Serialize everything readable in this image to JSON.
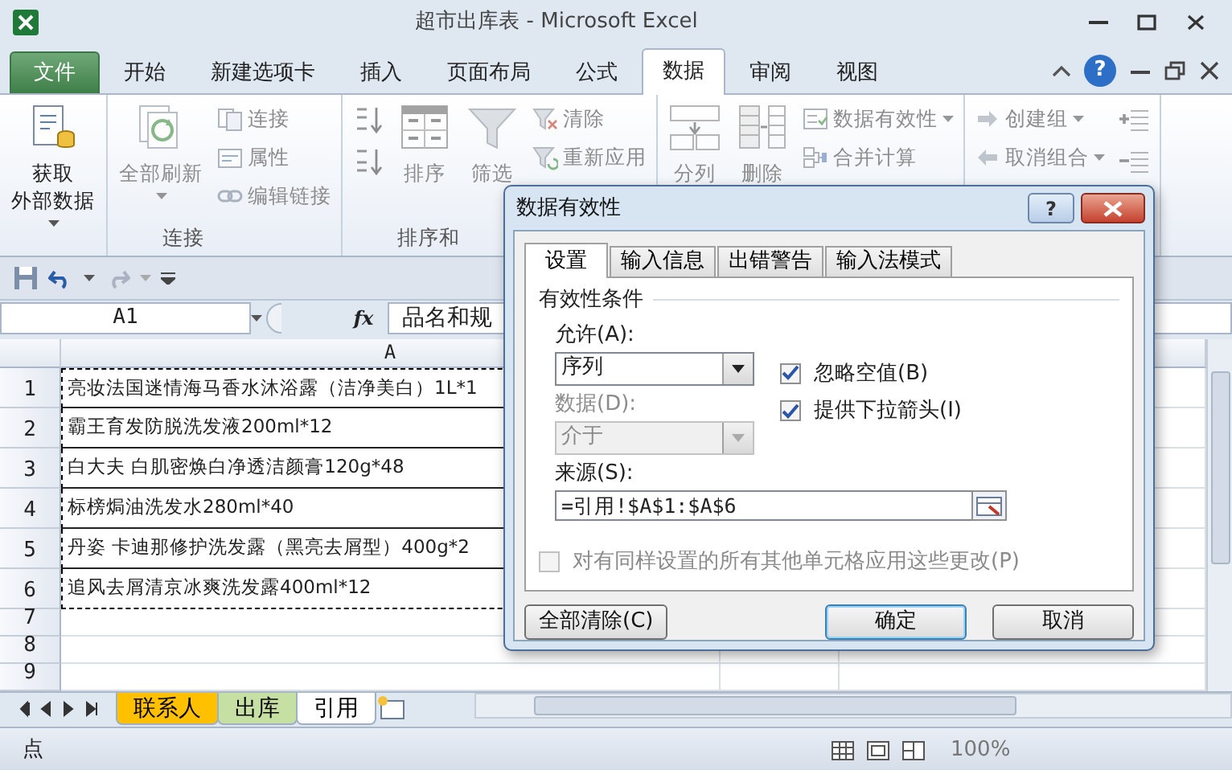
{
  "window": {
    "title": "超市出库表 - Microsoft Excel"
  },
  "ribbon_tabs": [
    {
      "label": "文件",
      "kind": "file",
      "selected": false
    },
    {
      "label": "开始",
      "kind": "tab",
      "selected": false
    },
    {
      "label": "新建选项卡",
      "kind": "tab",
      "selected": false
    },
    {
      "label": "插入",
      "kind": "tab",
      "selected": false
    },
    {
      "label": "页面布局",
      "kind": "tab",
      "selected": false
    },
    {
      "label": "公式",
      "kind": "tab",
      "selected": false
    },
    {
      "label": "数据",
      "kind": "tab",
      "selected": true
    },
    {
      "label": "审阅",
      "kind": "tab",
      "selected": false
    },
    {
      "label": "视图",
      "kind": "tab",
      "selected": false
    }
  ],
  "help_label": "?",
  "ribbon_groups": [
    {
      "columns": [
        [
          {
            "kind": "big",
            "lines": [
              "获取",
              "外部数据"
            ],
            "dropdown": true,
            "disabled": false
          }
        ]
      ]
    },
    {
      "label": "连接",
      "columns": [
        [
          {
            "kind": "big",
            "label": "全部刷新",
            "dropdown": true,
            "disabled": true
          }
        ],
        [
          {
            "kind": "small",
            "label": "连接",
            "disabled": true
          },
          {
            "kind": "small",
            "label": "属性",
            "disabled": true
          },
          {
            "kind": "small",
            "label": "编辑链接",
            "disabled": true
          }
        ]
      ]
    },
    {
      "label": "排序和",
      "columns": [
        [
          {
            "kind": "icon",
            "disabled": true
          },
          {
            "kind": "icon",
            "disabled": true
          }
        ],
        [
          {
            "kind": "big",
            "label": "排序",
            "disabled": true
          }
        ],
        [
          {
            "kind": "big",
            "label": "筛选",
            "disabled": true
          }
        ],
        [
          {
            "kind": "small",
            "label": "清除",
            "disabled": true
          },
          {
            "kind": "small",
            "label": "重新应用",
            "disabled": true
          }
        ]
      ]
    },
    {
      "columns": [
        [
          {
            "kind": "big",
            "label": "分列",
            "disabled": true
          }
        ],
        [
          {
            "kind": "big",
            "label": "删除",
            "disabled": true
          }
        ],
        [
          {
            "kind": "small",
            "label": "数据有效性",
            "dropdown": true,
            "disabled": true
          },
          {
            "kind": "small",
            "label": "合并计算",
            "disabled": true
          }
        ]
      ]
    },
    {
      "columns": [
        [
          {
            "kind": "small",
            "label": "创建组",
            "dropdown": true,
            "disabled": true
          },
          {
            "kind": "small",
            "label": "取消组合",
            "dropdown": true,
            "disabled": true
          }
        ],
        [
          {
            "kind": "icon",
            "disabled": true
          },
          {
            "kind": "icon",
            "disabled": true
          }
        ]
      ]
    }
  ],
  "formula_bar": {
    "name_box": "A1",
    "fx": "fx",
    "formula": "品名和规"
  },
  "columns": [
    {
      "label": "A"
    }
  ],
  "rows": [
    {
      "number": "1",
      "cells": [
        "亮妆法国迷情海马香水沐浴露（洁净美白）1L*1"
      ],
      "marquee": true
    },
    {
      "number": "2",
      "cells": [
        "霸王育发防脱洗发液200ml*12"
      ],
      "marquee": true
    },
    {
      "number": "3",
      "cells": [
        "白大夫 白肌密焕白净透洁颜膏120g*48"
      ],
      "marquee": true
    },
    {
      "number": "4",
      "cells": [
        "标榜焗油洗发水280ml*40"
      ],
      "marquee": true
    },
    {
      "number": "5",
      "cells": [
        "丹姿 卡迪那修护洗发露（黑亮去屑型）400g*2"
      ],
      "marquee": true
    },
    {
      "number": "6",
      "cells": [
        "追风去屑清京冰爽洗发露400ml*12"
      ],
      "marquee": true
    },
    {
      "number": "7",
      "marquee": false
    },
    {
      "number": "8",
      "marquee": false
    },
    {
      "number": "9",
      "marquee": false
    }
  ],
  "sheet_tabs": [
    {
      "label": "联系人",
      "color": "#ffc000",
      "selected": false
    },
    {
      "label": "出库",
      "color": "#c6e0a4",
      "selected": false
    },
    {
      "label": "引用",
      "selected": true
    }
  ],
  "status_bar": {
    "mode": "点",
    "zoom": "100%"
  },
  "dialog": {
    "title": "数据有效性",
    "help_label": "?",
    "tabs": [
      {
        "label": "设置",
        "selected": true
      },
      {
        "label": "输入信息",
        "selected": false
      },
      {
        "label": "出错警告",
        "selected": false
      },
      {
        "label": "输入法模式",
        "selected": false
      }
    ],
    "section": "有效性条件",
    "allow": {
      "label": "允许(A):",
      "value": "序列",
      "disabled": false
    },
    "data": {
      "label": "数据(D):",
      "value": "介于",
      "disabled": true
    },
    "checkboxes": [
      {
        "label": "忽略空值(B)",
        "checked": true,
        "disabled": false
      },
      {
        "label": "提供下拉箭头(I)",
        "checked": true,
        "disabled": false
      }
    ],
    "source": {
      "label": "来源(S):",
      "value": "=引用!$A$1:$A$6"
    },
    "apply_all": {
      "label": "对有同样设置的所有其他单元格应用这些更改(P)",
      "checked": false,
      "disabled": true
    },
    "buttons": [
      {
        "label": "全部清除(C)",
        "kind": "left",
        "default": false
      },
      {
        "label": "确定",
        "kind": "right",
        "default": true
      },
      {
        "label": "取消",
        "kind": "right",
        "default": false
      }
    ]
  }
}
